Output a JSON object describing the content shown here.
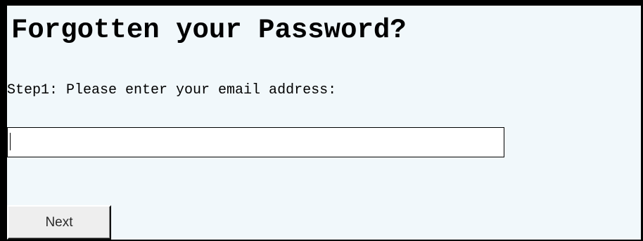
{
  "form": {
    "title": "Forgotten your Password?",
    "step_label": "Step1: Please enter your email address:",
    "email_value": "",
    "next_label": "Next"
  },
  "colors": {
    "background": "#f1f8fb",
    "border": "#000000",
    "input_background": "#ffffff",
    "button_background": "#eeeeee"
  }
}
